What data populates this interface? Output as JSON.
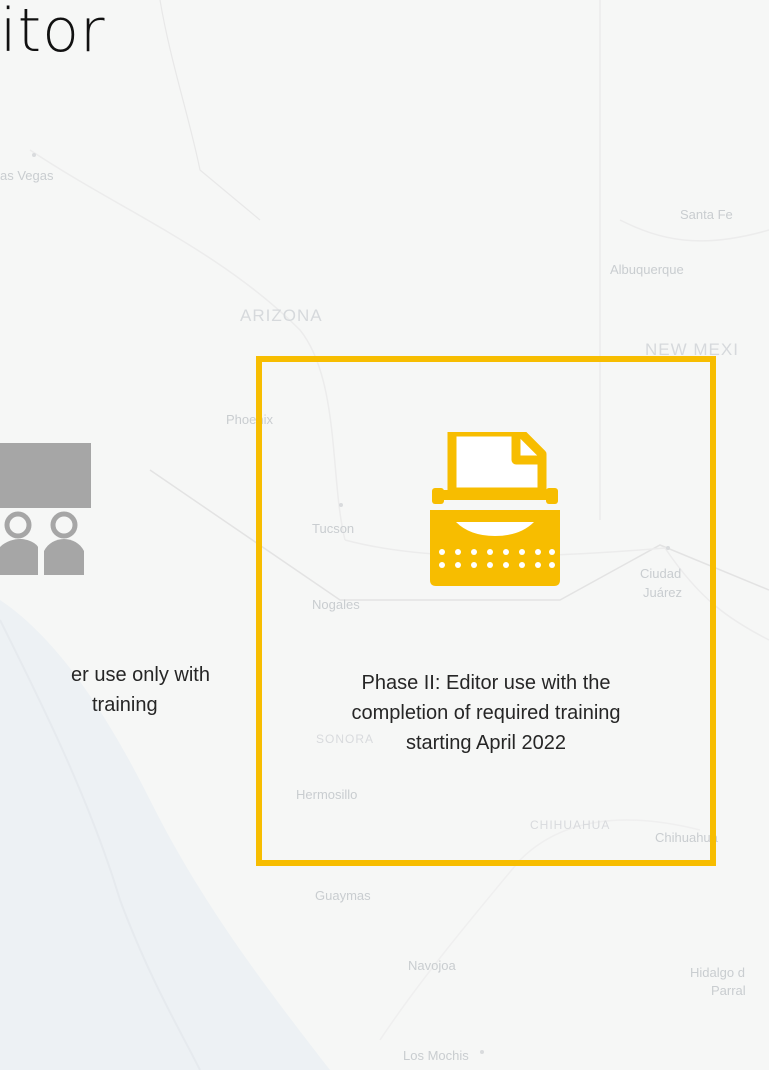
{
  "title": "itor",
  "map_labels": {
    "las_vegas": "as Vegas",
    "santa_fe": "Santa Fe",
    "albuquerque": "Albuquerque",
    "arizona": "ARIZONA",
    "new_mexico": "NEW MEXI",
    "phoenix": "Phoenix",
    "tucson": "Tucson",
    "nogales": "Nogales",
    "ciudad_juarez_1": "Ciudad",
    "ciudad_juarez_2": "Juárez",
    "sonora": "SONORA",
    "hermosillo": "Hermosillo",
    "chihuahua_state": "CHIHUAHUA",
    "chihuahua_city": "Chihuahua",
    "guaymas": "Guaymas",
    "navojoa": "Navojoa",
    "hidalgo_1": "Hidalgo d",
    "hidalgo_2": "Parral",
    "los_mochis": "Los Mochis"
  },
  "phase1": {
    "line1": "er use only with",
    "line2": "training"
  },
  "phase2": {
    "line1": "Phase II: Editor use with the",
    "line2": "completion of required training",
    "line3": "starting April 2022"
  },
  "colors": {
    "accent": "#f7bd00",
    "icon_gray": "#a6a6a6",
    "map_background": "#f6f7f6"
  },
  "icons": {
    "phase1": "users-group-icon",
    "phase2": "typewriter-icon"
  }
}
